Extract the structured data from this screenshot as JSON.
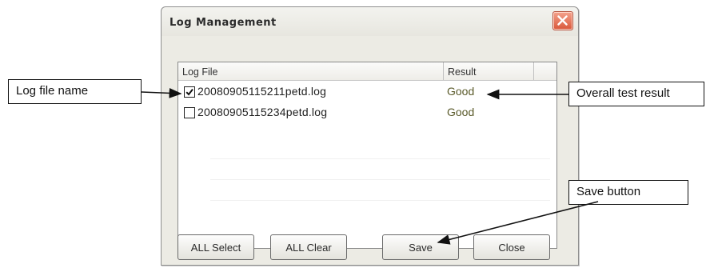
{
  "dialog": {
    "title": "Log Management",
    "close_icon": "close-x-icon",
    "accent_color": "#d9573a"
  },
  "list": {
    "columns": [
      "Log File",
      "Result"
    ],
    "rows": [
      {
        "checked": true,
        "file": "20080905115211petd.log",
        "result": "Good"
      },
      {
        "checked": false,
        "file": "20080905115234petd.log",
        "result": "Good"
      }
    ]
  },
  "buttons": {
    "all_select": "ALL Select",
    "all_clear": "ALL Clear",
    "save": "Save",
    "close": "Close"
  },
  "callouts": {
    "log_file_name": "Log file name",
    "overall_result": "Overall test result",
    "save_button": "Save button"
  }
}
